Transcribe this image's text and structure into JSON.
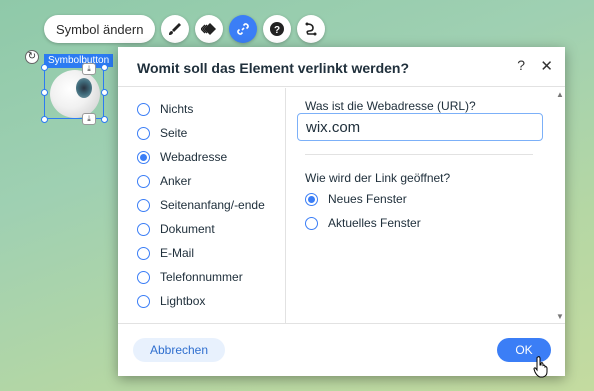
{
  "toolbar": {
    "change_symbol_label": "Symbol ändern",
    "icons": [
      "brush-icon",
      "animation-icon",
      "link-icon",
      "help-icon",
      "connect-icon"
    ]
  },
  "element": {
    "label": "Symbolbutton"
  },
  "dialog": {
    "title": "Womit soll das Element verlinkt werden?",
    "help": "?",
    "close": "✕",
    "link_types": [
      {
        "label": "Nichts",
        "checked": false
      },
      {
        "label": "Seite",
        "checked": false
      },
      {
        "label": "Webadresse",
        "checked": true
      },
      {
        "label": "Anker",
        "checked": false
      },
      {
        "label": "Seitenanfang/-ende",
        "checked": false
      },
      {
        "label": "Dokument",
        "checked": false
      },
      {
        "label": "E-Mail",
        "checked": false
      },
      {
        "label": "Telefonnummer",
        "checked": false
      },
      {
        "label": "Lightbox",
        "checked": false
      }
    ],
    "url_label": "Was ist die Webadresse (URL)?",
    "url_value": "wix.com",
    "open_label": "Wie wird der Link geöffnet?",
    "open_options": [
      {
        "label": "Neues Fenster",
        "checked": true
      },
      {
        "label": "Aktuelles Fenster",
        "checked": false
      }
    ],
    "cancel_label": "Abbrechen",
    "ok_label": "OK"
  },
  "colors": {
    "accent": "#3b7ef6",
    "selection": "#2c7bf2"
  }
}
